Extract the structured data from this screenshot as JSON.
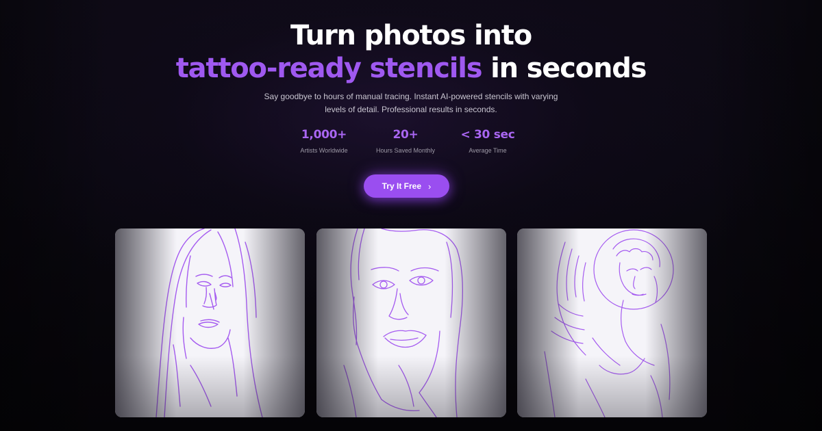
{
  "hero": {
    "headline_line1": "Turn photos into",
    "headline_accent": "tattoo-ready stencils",
    "headline_tail": " in seconds",
    "subtitle": "Say goodbye to hours of manual tracing. Instant AI-powered stencils with varying levels of detail. Professional results in seconds."
  },
  "stats": [
    {
      "value": "1,000+",
      "label": "Artists Worldwide"
    },
    {
      "value": "20+",
      "label": "Hours Saved Monthly"
    },
    {
      "value": "< 30 sec",
      "label": "Average Time"
    }
  ],
  "cta": {
    "label": "Try It Free",
    "icon": "chevron-right-icon"
  },
  "gallery": [
    {
      "subject": "veiled-woman-stencil"
    },
    {
      "subject": "woman-portrait-stencil"
    },
    {
      "subject": "angel-stencil"
    }
  ],
  "colors": {
    "accent": "#9f59f0",
    "background": "#050407",
    "stencil_line": "#a55bf0",
    "card_background": "#f5f4f9"
  }
}
